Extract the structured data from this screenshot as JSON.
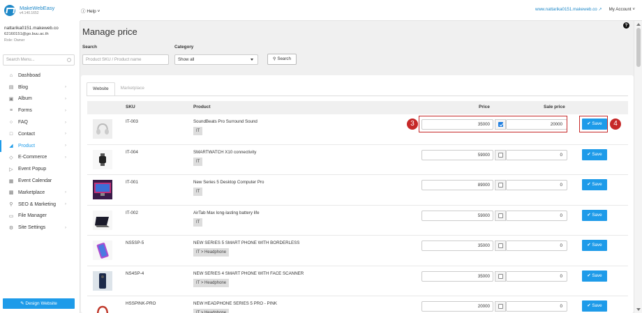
{
  "brand": {
    "name": "MakeWebEasy",
    "version": "v4.140.1652"
  },
  "topbar": {
    "help": "Help",
    "site_url": "www.nattarika0151.makeweb.co",
    "account": "My Account"
  },
  "user": {
    "host": "nattarika0151.makeweb.co",
    "email": "62160151@go.buu.ac.th",
    "role": "Role: Owner"
  },
  "sidebar": {
    "search_placeholder": "Search Menu...",
    "items": [
      {
        "label": "Dashboad",
        "icon": "home-icon",
        "chevron": false,
        "active": false
      },
      {
        "label": "Blog",
        "icon": "document-icon",
        "chevron": true,
        "active": false
      },
      {
        "label": "Album",
        "icon": "image-icon",
        "chevron": true,
        "active": false
      },
      {
        "label": "Forms",
        "icon": "list-icon",
        "chevron": true,
        "active": false
      },
      {
        "label": "FAQ",
        "icon": "faq-icon",
        "chevron": true,
        "active": false
      },
      {
        "label": "Contact",
        "icon": "contact-icon",
        "chevron": true,
        "active": false
      },
      {
        "label": "Product",
        "icon": "cart-icon",
        "chevron": true,
        "active": true
      },
      {
        "label": "E-Commerce",
        "icon": "tag-icon",
        "chevron": true,
        "active": false
      },
      {
        "label": "Event Popup",
        "icon": "megaphone-icon",
        "chevron": false,
        "active": false
      },
      {
        "label": "Event Calendar",
        "icon": "calendar-icon",
        "chevron": false,
        "active": false
      },
      {
        "label": "Marketplace",
        "icon": "store-icon",
        "chevron": true,
        "active": false
      },
      {
        "label": "SEO & Marketing",
        "icon": "search-icon",
        "chevron": true,
        "active": false
      },
      {
        "label": "File Manager",
        "icon": "folder-icon",
        "chevron": false,
        "active": false
      },
      {
        "label": "Site Settings",
        "icon": "gear-icon",
        "chevron": true,
        "active": false
      }
    ],
    "design_button": "Design Website"
  },
  "main": {
    "title": "Manage price",
    "search_label": "Search",
    "search_placeholder": "Product SKU / Product name",
    "category_label": "Category",
    "category_value": "Show all",
    "search_button": "Search",
    "tabs": [
      "Website",
      "Marketplace"
    ],
    "columns": {
      "sku": "SKU",
      "product": "Product",
      "price": "Price",
      "sale": "Sale price"
    },
    "save_label": "Save",
    "rows": [
      {
        "sku": "IT-003",
        "name": "SoundBeats Pro Surround Sound",
        "category": "IT",
        "price": "35000",
        "sale_checked": true,
        "sale": "20000"
      },
      {
        "sku": "IT-004",
        "name": "SMARTWATCH X10 connectivity",
        "category": "IT",
        "price": "59000",
        "sale_checked": false,
        "sale": "0"
      },
      {
        "sku": "IT-001",
        "name": "New Series 5 Desktop Computer Pro",
        "category": "IT",
        "price": "89000",
        "sale_checked": false,
        "sale": "0"
      },
      {
        "sku": "IT-002",
        "name": "AirTab Max long-lasting battery life",
        "category": "IT",
        "price": "59000",
        "sale_checked": false,
        "sale": "0"
      },
      {
        "sku": "NS5SP-5",
        "name": "NEW SERIES 5 SMART PHONE WITH BORDERLESS",
        "category": "IT > Headphone",
        "price": "35000",
        "sale_checked": false,
        "sale": "0"
      },
      {
        "sku": "NS4SP-4",
        "name": "NEW SERIES 4 SMART PHONE WITH FACE SCANNER",
        "category": "IT > Headphone",
        "price": "35000",
        "sale_checked": false,
        "sale": "0"
      },
      {
        "sku": "HSSPINK-PRO",
        "name": "NEW HEADPHONE SERIES 5 PRO - PINK",
        "category": "IT > Headphone",
        "price": "20000",
        "sale_checked": false,
        "sale": "0"
      }
    ],
    "annotations": [
      "3",
      "4"
    ]
  }
}
